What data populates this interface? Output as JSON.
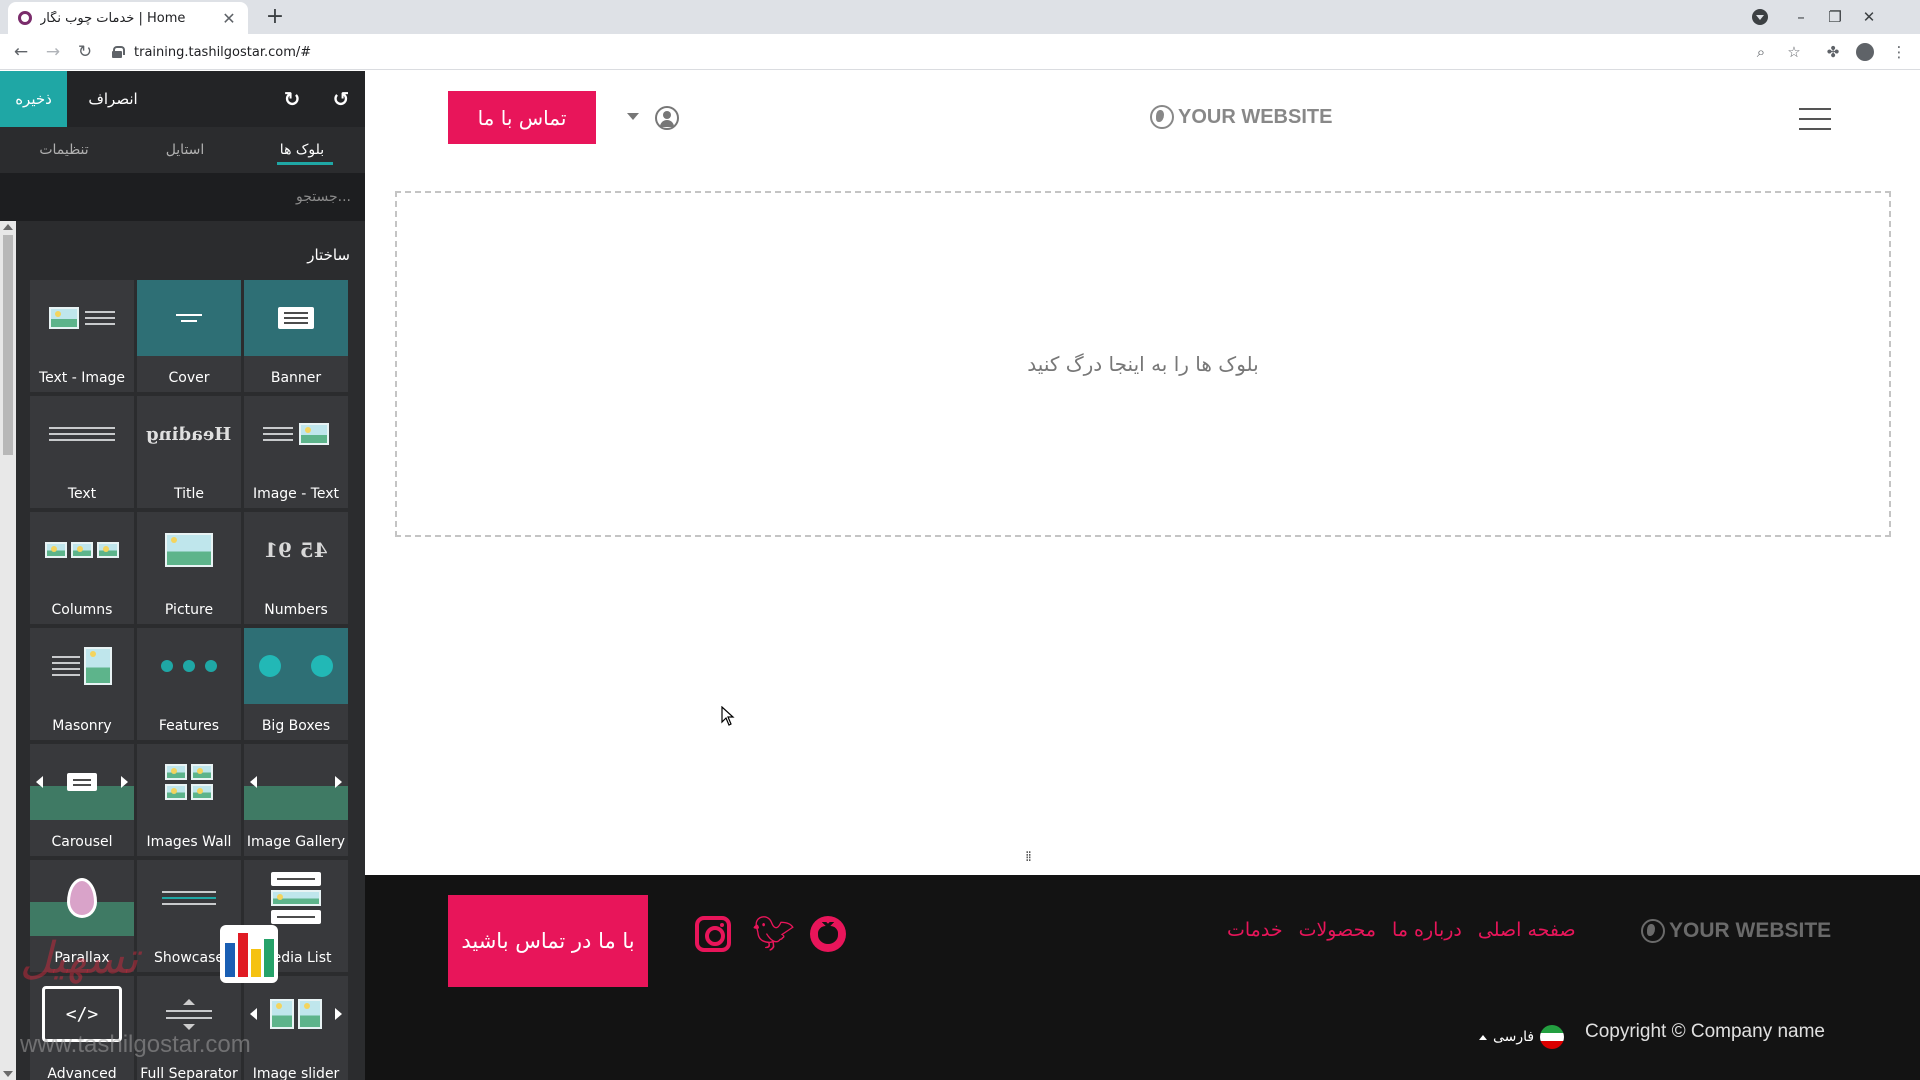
{
  "browser": {
    "tab_title": "خدمات چوب نگار | Home",
    "url": "training.tashilgostar.com/#",
    "new_tab": "+",
    "tab_close": "✕",
    "win_minimize": "–",
    "win_restore": "❐",
    "win_close": "✕"
  },
  "editor": {
    "save": "ذخیره",
    "cancel": "انصراف",
    "tabs": [
      "تنظیمات",
      "استایل",
      "بلوک ها"
    ],
    "active_tab": "بلوک ها",
    "search_placeholder": "جستجو...",
    "section_label": "ساختار",
    "blocks": [
      {
        "label": "Text - Image",
        "icon": "text-image-icon"
      },
      {
        "label": "Cover",
        "icon": "cover-icon"
      },
      {
        "label": "Banner",
        "icon": "banner-icon"
      },
      {
        "label": "Text",
        "icon": "text-icon"
      },
      {
        "label": "Title",
        "icon": "heading-icon"
      },
      {
        "label": "Image - Text",
        "icon": "image-text-icon"
      },
      {
        "label": "Columns",
        "icon": "columns-icon"
      },
      {
        "label": "Picture",
        "icon": "picture-icon"
      },
      {
        "label": "Numbers",
        "icon": "numbers-icon"
      },
      {
        "label": "Masonry",
        "icon": "masonry-icon"
      },
      {
        "label": "Features",
        "icon": "features-icon"
      },
      {
        "label": "Big Boxes",
        "icon": "big-boxes-icon"
      },
      {
        "label": "Carousel",
        "icon": "carousel-icon"
      },
      {
        "label": "Images Wall",
        "icon": "images-wall-icon"
      },
      {
        "label": "Image Gallery",
        "icon": "image-gallery-icon"
      },
      {
        "label": "Parallax",
        "icon": "parallax-icon"
      },
      {
        "label": "Showcase",
        "icon": "showcase-icon"
      },
      {
        "label": "Media List",
        "icon": "media-list-icon"
      },
      {
        "label": "Advanced",
        "icon": "advanced-icon"
      },
      {
        "label": "Full Separator",
        "icon": "separator-icon"
      },
      {
        "label": "Image slider",
        "icon": "image-slider-icon"
      }
    ],
    "watermark_url": "www.tashilgostar.com"
  },
  "site": {
    "contact_button": "تماس با ما",
    "logo_text": "YOUR WEBSITE",
    "dropzone_text": "بلوک ها را به اینجا درگ کنید",
    "drag_handle": "⁞⁞",
    "footer": {
      "contact_button": "با ما در تماس باشید",
      "nav": [
        "صفحه اصلی",
        "درباره ما",
        "محصولات",
        "خدمات"
      ],
      "logo_text": "YOUR WEBSITE",
      "language": "فارسی",
      "copyright": "Copyright © Company name"
    }
  },
  "colors": {
    "accent_pink": "#e8155a",
    "accent_teal": "#1fa7a5",
    "panel_bg": "#2b2c2e",
    "footer_bg": "#131313"
  }
}
